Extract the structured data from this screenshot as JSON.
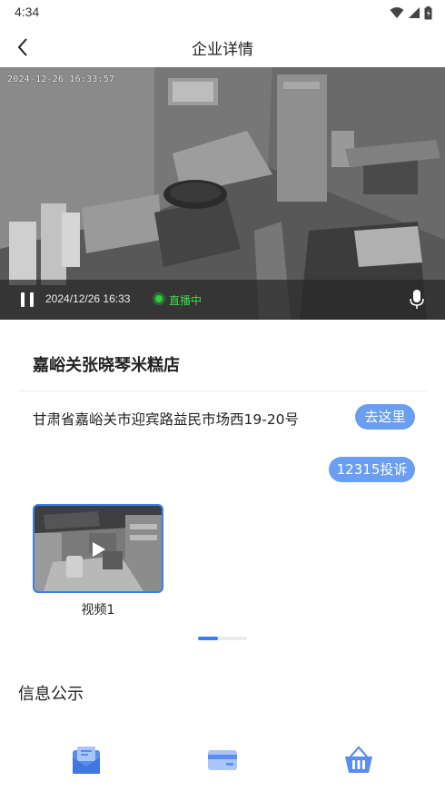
{
  "status_bar": {
    "time": "4:34"
  },
  "nav": {
    "title": "企业详情"
  },
  "video": {
    "overlay_timestamp": "2024-12-26 16:33:57",
    "control_time": "2024/12/26 16:33",
    "live_label": "直播中"
  },
  "enterprise": {
    "name": "嘉峪关张晓琴米糕店",
    "address": "甘肃省嘉峪关市迎宾路益民市场西19-20号",
    "navigate_label": "去这里",
    "complaint_label": "12315投诉"
  },
  "videos": [
    {
      "label": "视频1"
    }
  ],
  "carousel": {
    "active_index": 0,
    "count": 3
  },
  "info": {
    "title": "信息公示"
  },
  "bottom_items": [
    {
      "icon": "license-envelope-icon",
      "label": ""
    },
    {
      "icon": "card-icon",
      "label": ""
    },
    {
      "icon": "basket-icon",
      "label": ""
    }
  ],
  "colors": {
    "accent": "#3a7ff0",
    "pill": "#6a9ef0",
    "live": "#2ecc40",
    "icon": "#5b8def"
  }
}
